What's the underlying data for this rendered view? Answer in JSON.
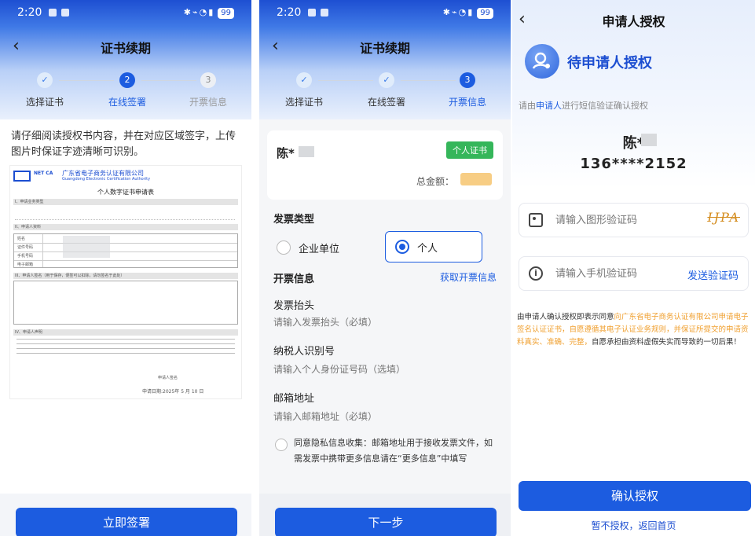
{
  "status": {
    "time": "2:20",
    "battery": "99"
  },
  "p1": {
    "title": "证书续期",
    "steps": [
      {
        "label": "选择证书",
        "num": "✓"
      },
      {
        "label": "在线签署",
        "num": "2"
      },
      {
        "label": "开票信息",
        "num": "3"
      }
    ],
    "instruction": "请仔细阅读授权书内容，并在对应区域签字，上传图片时保证字迹清晰可识别。",
    "doc": {
      "org_cn": "广东省电子商务认证有限公司",
      "org_en": "Guangdong Electronic Certification Authority",
      "logo": "NET CA",
      "form_title": "个人数字证书申请表",
      "sec1": "I、申请业务类型",
      "sec2": "II、申请人资料",
      "sec3": "III、申请人签名（用于保存，便签可以扣除，请勿签名于此处）",
      "sec4": "IV、申请人声明",
      "row_name": "姓名",
      "row_id": "证件号码",
      "row_phone": "手机号码",
      "row_email": "电子邮箱",
      "sign_label": "申请人签名",
      "date_text": "申请日期:2025年  5  月  10  日"
    },
    "button": "立即签署"
  },
  "p2": {
    "title": "证书续期",
    "steps": [
      {
        "label": "选择证书",
        "num": "✓"
      },
      {
        "label": "在线签署",
        "num": "✓"
      },
      {
        "label": "开票信息",
        "num": "3"
      }
    ],
    "name": "陈*",
    "badge": "个人证书",
    "total_label": "总金额：",
    "invoice_type_label": "发票类型",
    "opt_company": "企业单位",
    "opt_personal": "个人",
    "invoice_info_label": "开票信息",
    "get_info_link": "获取开票信息",
    "fields": [
      {
        "label": "发票抬头",
        "placeholder": "请输入发票抬头（必填）"
      },
      {
        "label": "纳税人识别号",
        "placeholder": "请输入个人身份证号码（选填）"
      },
      {
        "label": "邮箱地址",
        "placeholder": "请输入邮箱地址（必填）"
      }
    ],
    "consent": "同意隐私信息收集：邮箱地址用于接收发票文件，如需发票中携带更多信息请在“更多信息”中填写",
    "button": "下一步"
  },
  "p3": {
    "title": "申请人授权",
    "hero_title": "待申请人授权",
    "hint_pre": "请由",
    "hint_hl": "申请人",
    "hint_post": "进行短信验证确认授权",
    "name": "陈*",
    "phone": "136****2152",
    "captcha_placeholder": "请输入图形验证码",
    "captcha_text": "IJPA",
    "sms_placeholder": "请输入手机验证码",
    "send_code": "发送验证码",
    "agree_pre": "由申请人确认授权即表示同意",
    "agree_hl": "向广东省电子商务认证有限公司申请电子签名认证证书，自愿遵循其电子认证业务规则，并保证所提交的申请资料真实、准确、完整，",
    "agree_post": "自愿承担由资料虚假失实而导致的一切后果！",
    "confirm": "确认授权",
    "decline": "暂不授权，返回首页"
  },
  "colors": {
    "primary": "#1c5ce0",
    "status_bar": "#1c4ed1",
    "orange": "#f0a030",
    "green": "#35b65a"
  }
}
